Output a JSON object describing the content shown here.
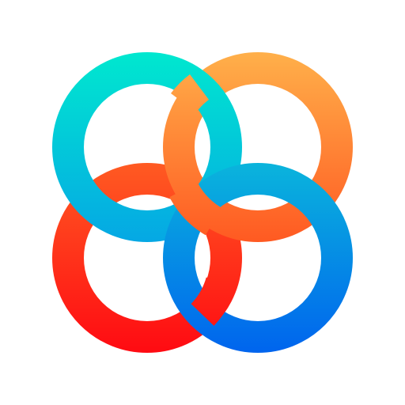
{
  "logo": {
    "name": "interlocking-rings-logo",
    "rings": [
      {
        "name": "teal-ring",
        "color_top": "#00E8CF",
        "color_bottom": "#05A8E4"
      },
      {
        "name": "orange-ring",
        "color_top": "#FFB04A",
        "color_bottom": "#FF5A22"
      },
      {
        "name": "red-ring",
        "color_top": "#FF5A22",
        "color_bottom": "#FF0A12"
      },
      {
        "name": "blue-ring",
        "color_top": "#0AB4DC",
        "color_bottom": "#0064EE"
      }
    ],
    "background": "#FFFFFF"
  }
}
